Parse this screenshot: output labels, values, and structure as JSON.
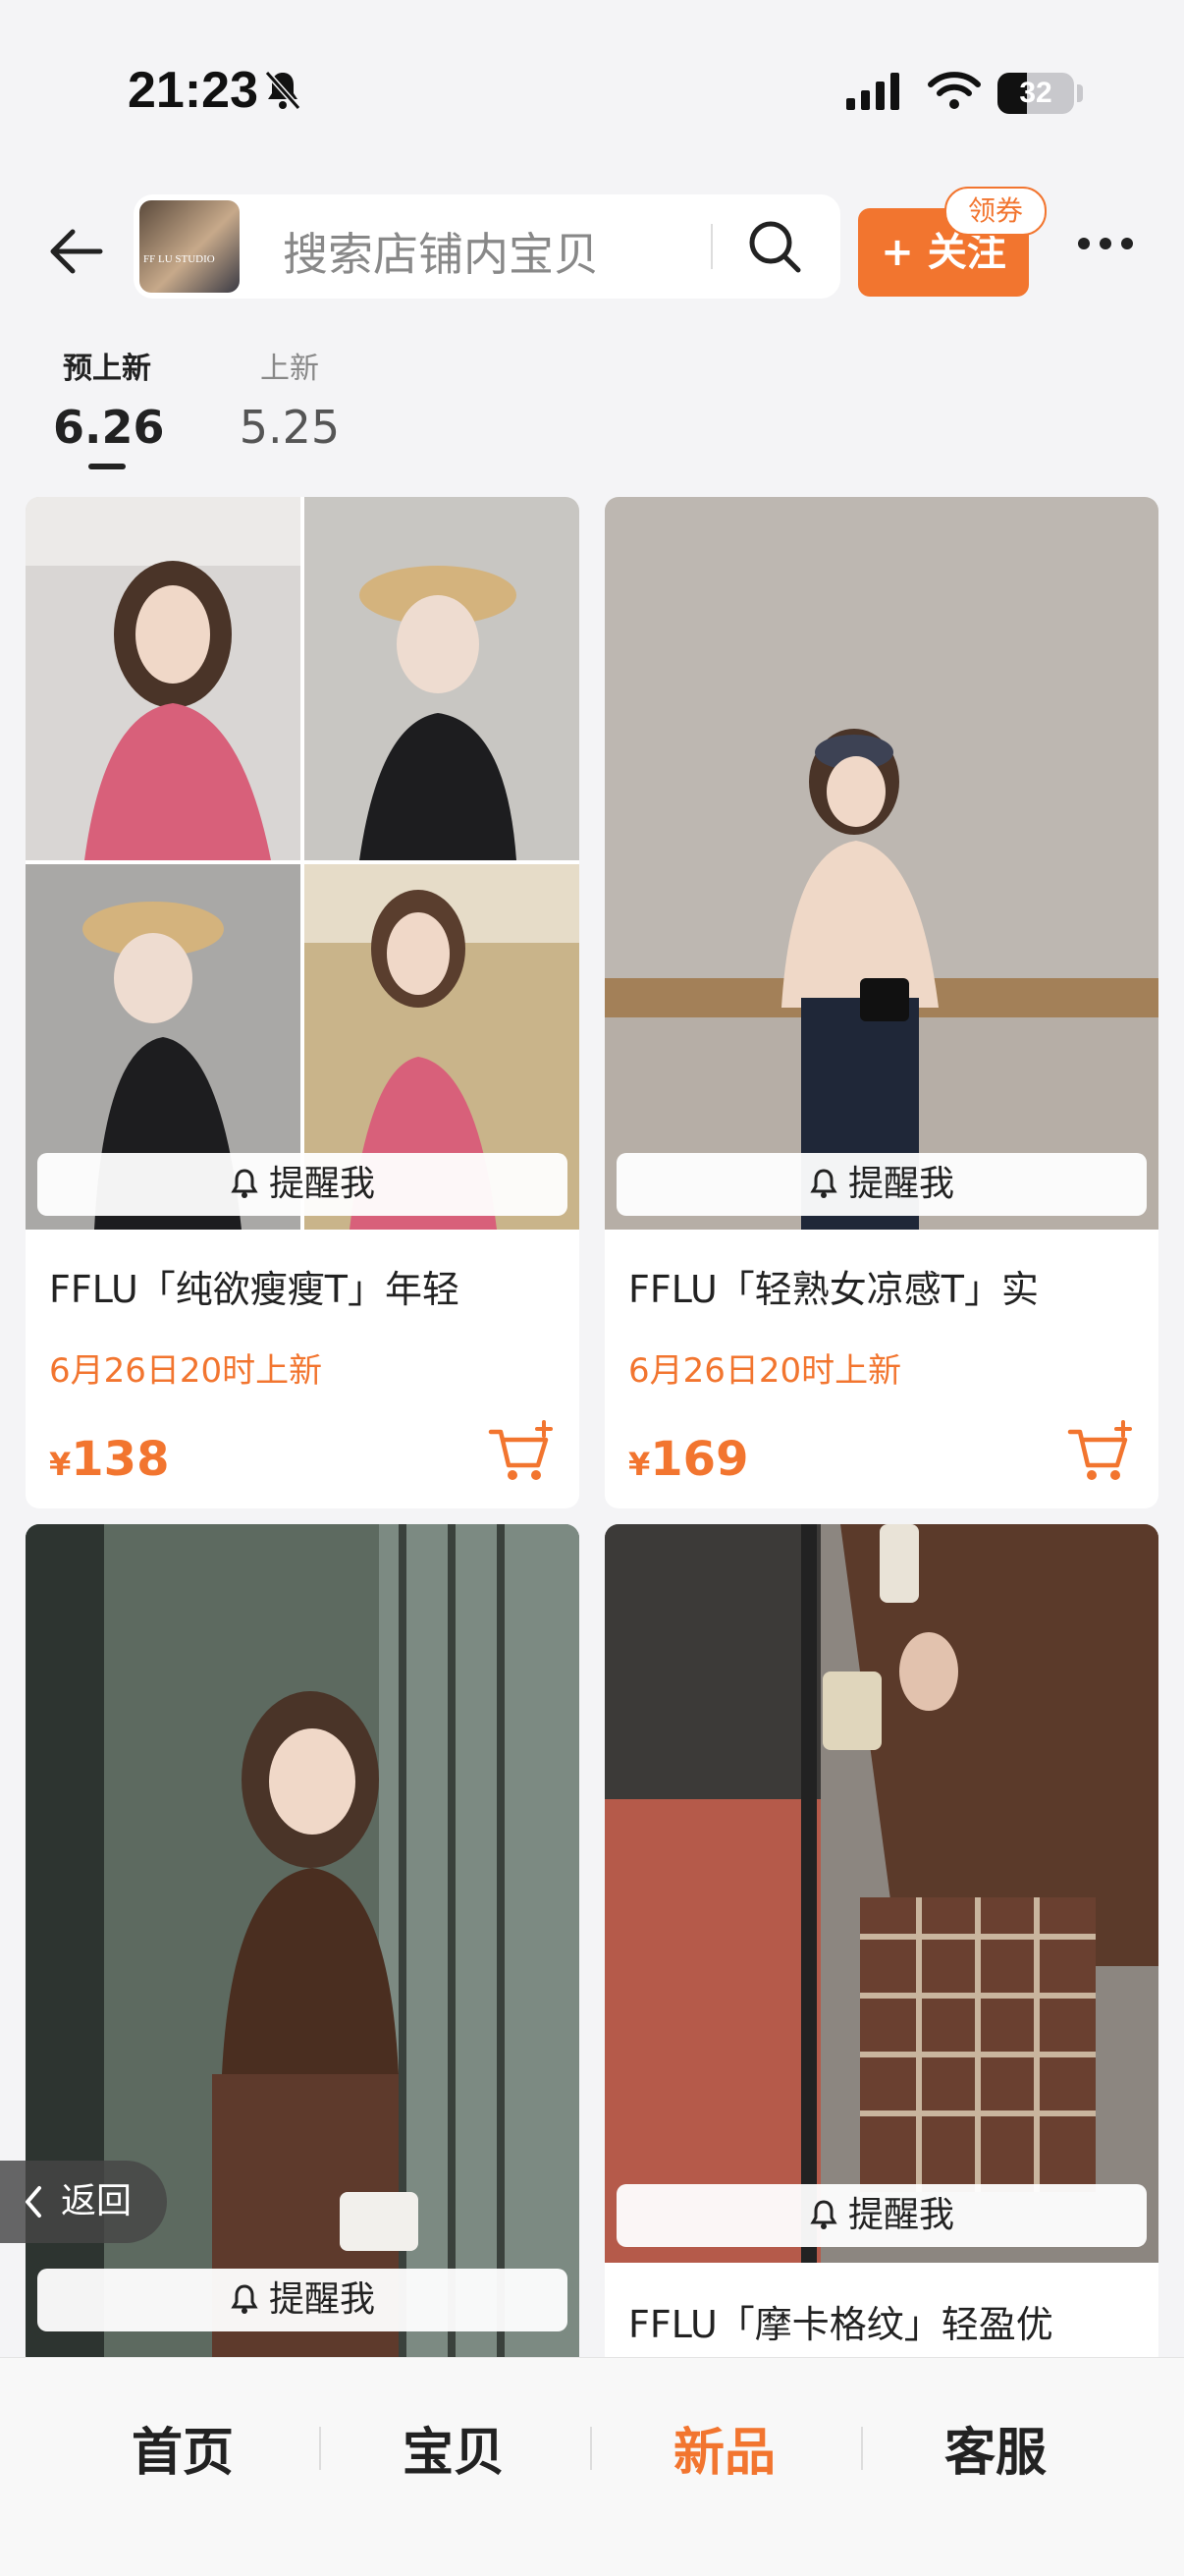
{
  "status_bar": {
    "time": "21:23",
    "battery": "32"
  },
  "header": {
    "shop_logo_text": "FF LU STUDIO",
    "search_placeholder": "搜索店铺内宝贝",
    "follow_label": "+ 关注",
    "coupon_label": "领券"
  },
  "tabs": [
    {
      "label": "预上新",
      "date": "6.26",
      "active": true
    },
    {
      "label": "上新",
      "date": "5.25",
      "active": false
    }
  ],
  "products": [
    {
      "title": "FFLU「纯欲瘦瘦T」年轻",
      "release": "6月26日20时上新",
      "currency": "¥",
      "price": "138",
      "remind": "提醒我"
    },
    {
      "title": "FFLU「轻熟女凉感T」实",
      "release": "6月26日20时上新",
      "currency": "¥",
      "price": "169",
      "remind": "提醒我"
    },
    {
      "title": "",
      "release": "",
      "currency": "",
      "price": "",
      "remind": "提醒我"
    },
    {
      "title": "FFLU「摩卡格纹」轻盈优",
      "release": "",
      "currency": "",
      "price": "",
      "remind": "提醒我"
    }
  ],
  "float_back_label": "返回",
  "bottom_nav": [
    {
      "label": "首页",
      "active": false
    },
    {
      "label": "宝贝",
      "active": false
    },
    {
      "label": "新品",
      "active": true
    },
    {
      "label": "客服",
      "active": false
    }
  ],
  "colors": {
    "accent": "#f2752f",
    "background": "#f4f4f6"
  }
}
